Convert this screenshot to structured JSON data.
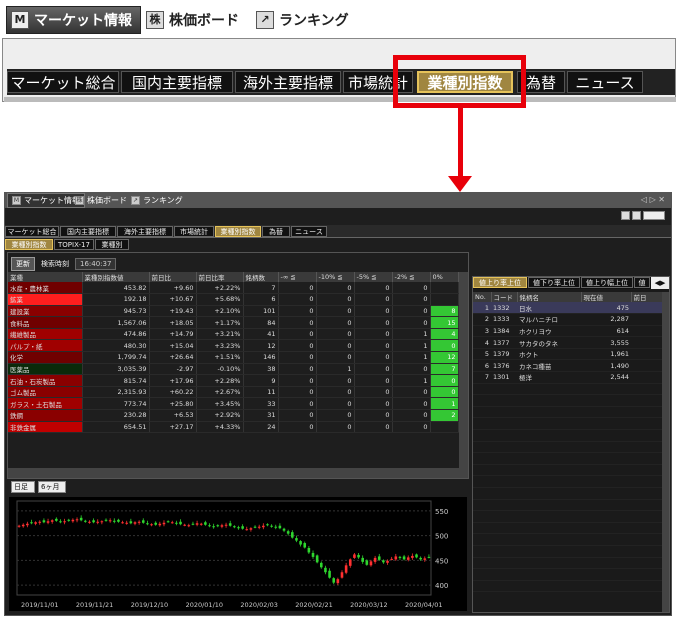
{
  "top_tabs": [
    {
      "label": "マーケット情報",
      "icon": "M"
    },
    {
      "label": "株価ボード",
      "icon": "株"
    },
    {
      "label": "ランキング",
      "icon": "↗"
    }
  ],
  "zoom_tabs": [
    "マーケット総合",
    "国内主要指標",
    "海外主要指標",
    "市場統計",
    "業種別指数",
    "為替",
    "ニュース"
  ],
  "win_tabs": [
    {
      "label": "マーケット情報",
      "icon": "M"
    },
    {
      "label": "株価ボード",
      "icon": "株"
    },
    {
      "label": "ランキング",
      "icon": "↗"
    }
  ],
  "sub_tabs": [
    "マーケット総合",
    "国内主要指標",
    "海外主要指標",
    "市場統計",
    "業種別指数",
    "為替",
    "ニュース"
  ],
  "sub2_tabs": [
    "業種別指数",
    "TOPIX-17",
    "業種別"
  ],
  "toolbar": {
    "update": "更新",
    "time_label": "検索時刻",
    "time": "16:40:37"
  },
  "grid": {
    "headers": [
      "業種",
      "業種別指数値",
      "前日比",
      "前日比率",
      "銘柄数",
      "-∞ ≦",
      "-10% ≦",
      "-5% ≦",
      "-2% ≦",
      "0%"
    ],
    "rows": [
      {
        "name": "水産・農林業",
        "value": "453.82",
        "chg": "+9.60",
        "pct": "+2.22%",
        "cnt": "7",
        "a": "0",
        "b": "0",
        "c": "0",
        "d": "0",
        "e": "",
        "color": "#700000"
      },
      {
        "name": "鉱業",
        "value": "192.18",
        "chg": "+10.67",
        "pct": "+5.68%",
        "cnt": "6",
        "a": "0",
        "b": "0",
        "c": "0",
        "d": "0",
        "e": "",
        "color": "#ff1e1e"
      },
      {
        "name": "建設業",
        "value": "945.73",
        "chg": "+19.43",
        "pct": "+2.10%",
        "cnt": "101",
        "a": "0",
        "b": "0",
        "c": "0",
        "d": "0",
        "e": "8",
        "color": "#8a0000"
      },
      {
        "name": "食料品",
        "value": "1,567.06",
        "chg": "+18.05",
        "pct": "+1.17%",
        "cnt": "84",
        "a": "0",
        "b": "0",
        "c": "0",
        "d": "0",
        "e": "15",
        "color": "#700000"
      },
      {
        "name": "繊維製品",
        "value": "474.86",
        "chg": "+14.79",
        "pct": "+3.21%",
        "cnt": "41",
        "a": "0",
        "b": "0",
        "c": "0",
        "d": "1",
        "e": "4",
        "color": "#a00000"
      },
      {
        "name": "パルプ・紙",
        "value": "480.30",
        "chg": "+15.04",
        "pct": "+3.23%",
        "cnt": "12",
        "a": "0",
        "b": "0",
        "c": "0",
        "d": "1",
        "e": "0",
        "color": "#a00000"
      },
      {
        "name": "化学",
        "value": "1,799.74",
        "chg": "+26.64",
        "pct": "+1.51%",
        "cnt": "146",
        "a": "0",
        "b": "0",
        "c": "0",
        "d": "1",
        "e": "12",
        "color": "#700000"
      },
      {
        "name": "医薬品",
        "value": "3,035.39",
        "chg": "-2.97",
        "pct": "-0.10%",
        "cnt": "38",
        "a": "0",
        "b": "1",
        "c": "0",
        "d": "0",
        "e": "7",
        "color": "#0a2a0a"
      },
      {
        "name": "石油・石炭製品",
        "value": "815.74",
        "chg": "+17.96",
        "pct": "+2.28%",
        "cnt": "9",
        "a": "0",
        "b": "0",
        "c": "0",
        "d": "1",
        "e": "0",
        "color": "#8a0000"
      },
      {
        "name": "ゴム製品",
        "value": "2,315.93",
        "chg": "+60.22",
        "pct": "+2.67%",
        "cnt": "11",
        "a": "0",
        "b": "0",
        "c": "0",
        "d": "0",
        "e": "0",
        "color": "#8a0000"
      },
      {
        "name": "ガラス・土石製品",
        "value": "773.74",
        "chg": "+25.80",
        "pct": "+3.45%",
        "cnt": "33",
        "a": "0",
        "b": "0",
        "c": "0",
        "d": "0",
        "e": "1",
        "color": "#a00000"
      },
      {
        "name": "鉄鋼",
        "value": "230.28",
        "chg": "+6.53",
        "pct": "+2.92%",
        "cnt": "31",
        "a": "0",
        "b": "0",
        "c": "0",
        "d": "0",
        "e": "2",
        "color": "#8a0000"
      },
      {
        "name": "非鉄金属",
        "value": "654.51",
        "chg": "+27.17",
        "pct": "+4.33%",
        "cnt": "24",
        "a": "0",
        "b": "0",
        "c": "0",
        "d": "0",
        "e": "",
        "color": "#c00000"
      }
    ]
  },
  "rank_tabs": [
    "値上り率上位",
    "値下り率上位",
    "値上り幅上位",
    "値"
  ],
  "rank": {
    "headers": [
      "No.",
      "コード",
      "銘柄名",
      "現在値",
      "前日"
    ],
    "rows": [
      {
        "no": "1",
        "code": "1332",
        "name": "日水",
        "price": "475"
      },
      {
        "no": "2",
        "code": "1333",
        "name": "マルハニチロ",
        "price": "2,287"
      },
      {
        "no": "3",
        "code": "1384",
        "name": "ホクリヨウ",
        "price": "614"
      },
      {
        "no": "4",
        "code": "1377",
        "name": "サカタのタネ",
        "price": "3,555"
      },
      {
        "no": "5",
        "code": "1379",
        "name": "ホクト",
        "price": "1,961"
      },
      {
        "no": "6",
        "code": "1376",
        "name": "カネコ種苗",
        "price": "1,490"
      },
      {
        "no": "7",
        "code": "1301",
        "name": "極洋",
        "price": "2,544"
      }
    ]
  },
  "chart_controls": {
    "period": "日足",
    "range": "6ヶ月"
  },
  "chart_data": {
    "type": "candlestick",
    "x_labels": [
      "2019/11/01",
      "2019/11/21",
      "2019/12/10",
      "2020/01/10",
      "2020/02/03",
      "2020/02/21",
      "2020/03/12",
      "2020/04/01"
    ],
    "y_ticks": [
      550,
      500,
      450,
      400
    ],
    "ylim": [
      380,
      570
    ],
    "close": [
      520,
      522,
      524,
      525,
      527,
      528,
      527,
      529,
      531,
      530,
      528,
      529,
      530,
      532,
      533,
      531,
      529,
      528,
      527,
      528,
      529,
      530,
      531,
      529,
      528,
      527,
      526,
      525,
      527,
      528,
      526,
      524,
      523,
      522,
      524,
      526,
      528,
      527,
      525,
      523,
      522,
      521,
      523,
      525,
      524,
      522,
      520,
      518,
      519,
      521,
      522,
      520,
      518,
      516,
      514,
      513,
      515,
      517,
      518,
      520,
      521,
      519,
      517,
      515,
      510,
      504,
      496,
      490,
      482,
      476,
      466,
      457,
      446,
      436,
      426,
      415,
      405,
      412,
      426,
      440,
      452,
      462,
      456,
      447,
      441,
      448,
      455,
      451,
      446,
      449,
      453,
      458,
      455,
      452,
      456,
      459,
      456,
      452,
      454,
      456
    ]
  }
}
